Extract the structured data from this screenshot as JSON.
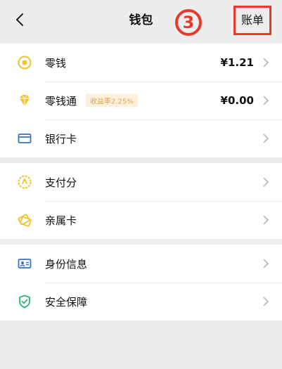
{
  "header": {
    "title": "钱包",
    "step_marker": "3",
    "bill_label": "账单"
  },
  "colors": {
    "accent_green": "#2bb673",
    "coin_yellow": "#f3c12d",
    "highlight_red": "#e83a2c",
    "card_blue": "#3a73c4"
  },
  "groups": [
    {
      "items": [
        {
          "icon": "coin-icon",
          "label": "零钱",
          "value": "¥1.21"
        },
        {
          "icon": "diamond-icon",
          "label": "零钱通",
          "tag": "收益率2.25%",
          "value": "¥0.00"
        },
        {
          "icon": "bank-card-icon",
          "label": "银行卡"
        }
      ]
    },
    {
      "items": [
        {
          "icon": "payment-score-icon",
          "label": "支付分"
        },
        {
          "icon": "family-card-icon",
          "label": "亲属卡"
        }
      ]
    },
    {
      "items": [
        {
          "icon": "id-card-icon",
          "label": "身份信息"
        },
        {
          "icon": "shield-icon",
          "label": "安全保障"
        }
      ]
    }
  ]
}
